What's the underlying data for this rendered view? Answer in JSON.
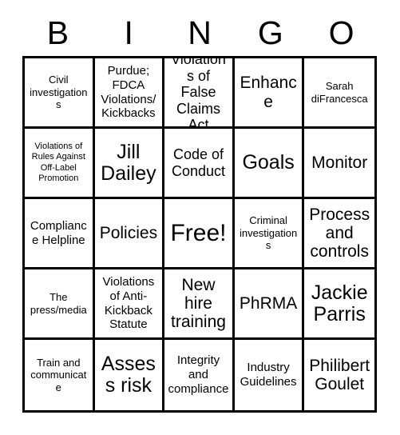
{
  "card": {
    "title": "BINGO",
    "header_letters": [
      "B",
      "I",
      "N",
      "G",
      "O"
    ],
    "free_space_label": "Free!",
    "rows": 5,
    "columns": 5,
    "border_color": "#000000",
    "background_color": "#ffffff",
    "text_color": "#000000",
    "cells": [
      {
        "text": "Civil investigations",
        "size": "fs-sm"
      },
      {
        "text": "Purdue; FDCA Violations/ Kickbacks",
        "size": "fs-md"
      },
      {
        "text": "Violations of False Claims Act",
        "size": "fs-lg"
      },
      {
        "text": "Enhance",
        "size": "fs-xl"
      },
      {
        "text": "Sarah diFrancesca",
        "size": "fs-sm"
      },
      {
        "text": "Violations of Rules Against Off-Label Promotion",
        "size": "fs-xs"
      },
      {
        "text": "Jill Dailey",
        "size": "fs-xxl"
      },
      {
        "text": "Code of Conduct",
        "size": "fs-lg"
      },
      {
        "text": "Goals",
        "size": "fs-xxl"
      },
      {
        "text": "Monitor",
        "size": "fs-xl"
      },
      {
        "text": "Compliance Helpline",
        "size": "fs-md"
      },
      {
        "text": "Policies",
        "size": "fs-xl"
      },
      {
        "text": "Free!",
        "size": "fs-free"
      },
      {
        "text": "Criminal investigations",
        "size": "fs-sm"
      },
      {
        "text": "Process and controls",
        "size": "fs-xl"
      },
      {
        "text": "The press/media",
        "size": "fs-sm"
      },
      {
        "text": "Violations of Anti-Kickback Statute",
        "size": "fs-md"
      },
      {
        "text": "New hire training",
        "size": "fs-xl"
      },
      {
        "text": "PhRMA",
        "size": "fs-xl"
      },
      {
        "text": "Jackie Parris",
        "size": "fs-xxl"
      },
      {
        "text": "Train and communicate",
        "size": "fs-sm"
      },
      {
        "text": "Assess risk",
        "size": "fs-xxl"
      },
      {
        "text": "Integrity and compliance",
        "size": "fs-md"
      },
      {
        "text": "Industry Guidelines",
        "size": "fs-md"
      },
      {
        "text": "Philibert Goulet",
        "size": "fs-xl"
      }
    ]
  }
}
